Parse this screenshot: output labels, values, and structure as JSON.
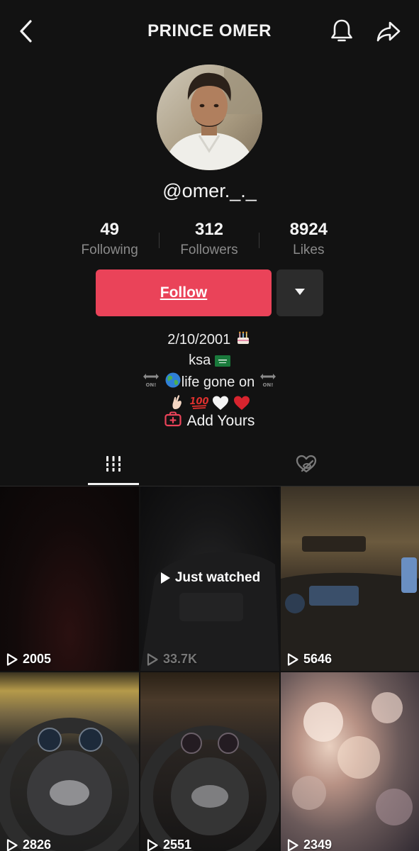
{
  "header": {
    "title": "PRINCE OMER",
    "back_icon": "chevron-left-icon",
    "bell_icon": "bell-icon",
    "share_icon": "share-arrow-icon"
  },
  "profile": {
    "handle": "@omer._._",
    "stats": [
      {
        "value": "49",
        "label": "Following"
      },
      {
        "value": "312",
        "label": "Followers"
      },
      {
        "value": "8924",
        "label": "Likes"
      }
    ]
  },
  "actions": {
    "follow_label": "Follow",
    "more_icon": "caret-down-icon"
  },
  "bio": {
    "line1": "2/10/2001",
    "line2": "ksa",
    "line3": "life gone on",
    "add_yours": "Add Yours"
  },
  "tabs": {
    "videos_icon": "grid-bars-icon",
    "liked_icon": "hidden-heart-icon"
  },
  "videos": [
    {
      "views": "2005"
    },
    {
      "views": "33.7K",
      "badge": "Just watched"
    },
    {
      "views": "5646"
    },
    {
      "views": "2826"
    },
    {
      "views": "2551"
    },
    {
      "views": "2349"
    }
  ],
  "colors": {
    "background": "#121212",
    "follow": "#ea4359",
    "secondary_button": "#2c2c2c",
    "muted_text": "#8a8a8a"
  }
}
